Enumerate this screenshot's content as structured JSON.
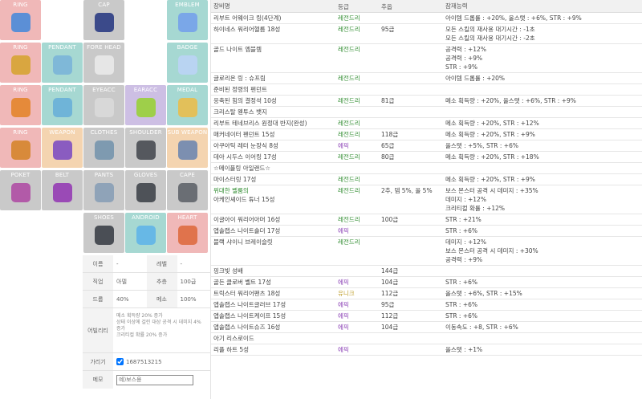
{
  "equipment_grid": {
    "slots": [
      {
        "label": "RING",
        "item": "ring-1"
      },
      {
        "label": "",
        "item": ""
      },
      {
        "label": "CAP",
        "item": "cap"
      },
      {
        "label": "",
        "item": ""
      },
      {
        "label": "EMBLEM",
        "item": "emblem"
      },
      {
        "label": "RING",
        "item": "ring-2"
      },
      {
        "label": "PENDANT",
        "item": "pendant-1"
      },
      {
        "label": "FORE HEAD",
        "item": "forehead"
      },
      {
        "label": "",
        "item": ""
      },
      {
        "label": "BADGE",
        "item": "badge"
      },
      {
        "label": "RING",
        "item": "ring-3"
      },
      {
        "label": "PENDANT",
        "item": "pendant-2"
      },
      {
        "label": "EYEACC",
        "item": "eye-accessory"
      },
      {
        "label": "EARACC",
        "item": "ear-accessory"
      },
      {
        "label": "MEDAL",
        "item": "medal"
      },
      {
        "label": "RING",
        "item": "ring-4"
      },
      {
        "label": "WEAPON",
        "item": "weapon"
      },
      {
        "label": "CLOTHES",
        "item": "clothes"
      },
      {
        "label": "SHOULDER",
        "item": "shoulder"
      },
      {
        "label": "SUB WEAPON",
        "item": "sub-weapon"
      },
      {
        "label": "POKET",
        "item": "pocket"
      },
      {
        "label": "BELT",
        "item": "belt"
      },
      {
        "label": "PANTS",
        "item": "pants"
      },
      {
        "label": "GLOVES",
        "item": "gloves"
      },
      {
        "label": "CAPE",
        "item": "cape"
      },
      {
        "label": "",
        "item": ""
      },
      {
        "label": "",
        "item": ""
      },
      {
        "label": "SHOES",
        "item": "shoes"
      },
      {
        "label": "ANDROID",
        "item": "android"
      },
      {
        "label": "HEART",
        "item": "heart"
      }
    ]
  },
  "char_info": {
    "name_label": "이름",
    "name_value": "-",
    "level_label": "레벨",
    "level_value": "-",
    "job_label": "직업",
    "job_value": "아델",
    "hunt_label": "추층",
    "hunt_value": "100급",
    "drop_label": "드롭",
    "drop_value": "40%",
    "meso_label": "메소",
    "meso_value": "100%",
    "ability_label": "어빌리티",
    "ability_lines": [
      "메소 획득량 20% 증가",
      "상태 이상에 걸린 대상 공격 시 데미지 4% 증가",
      "크리티컬 확률 20% 증가"
    ],
    "hide_label": "가리기",
    "hide_value": "1687513215",
    "memo_label": "메모",
    "memo_placeholder": "예)보스용"
  },
  "table": {
    "headers": {
      "name": "장비명",
      "grade": "등급",
      "star": "추옵",
      "potential": "잠재능력"
    },
    "rows": [
      {
        "name": "리부트 어웨이크 링(4단계)",
        "grade": "레전드리",
        "grade_class": "legend",
        "star": "",
        "potential": [
          "아이템 드롭률 : +20%, 올스탯 : +6%, STR : +9%"
        ]
      },
      {
        "name": "하이네스 워리어헬름 18성",
        "grade": "레전드리",
        "grade_class": "legend",
        "star": "95급",
        "potential": [
          "모든 스킬의 재사용 대기시간 : -1초",
          "모든 스킬의 재사용 대기시간 : -2초"
        ]
      },
      {
        "name": "골드 나이트 엠블렘",
        "grade": "레전드리",
        "grade_class": "legend",
        "star": "",
        "potential": [
          "공격력 : +12%",
          "공격력 : +9%",
          "STR : +9%"
        ]
      },
      {
        "name": "글로리온 링 : 슈프림",
        "grade": "레전드리",
        "grade_class": "legend",
        "star": "",
        "potential": [
          "아이템 드롭률 : +20%"
        ]
      },
      {
        "name": "준비된 정령의 펜던트",
        "grade": "",
        "grade_class": "",
        "star": "",
        "potential": []
      },
      {
        "name": "응축된 힘의 결정석 10성",
        "grade": "레전드리",
        "grade_class": "legend",
        "star": "81급",
        "potential": [
          "메소 획득량 : +20%, 올스탯 : +6%, STR : +9%"
        ]
      },
      {
        "name": "크리스탈 웬투스 뱃지",
        "grade": "",
        "grade_class": "",
        "star": "",
        "potential": []
      },
      {
        "name": "리부트 테네브리스 원정대 반지(완성)",
        "grade": "레전드리",
        "grade_class": "legend",
        "star": "",
        "potential": [
          "메소 획득량 : +20%, STR : +12%"
        ]
      },
      {
        "name": "매커네이터 펜던트 15성",
        "grade": "레전드리",
        "grade_class": "legend",
        "star": "118급",
        "potential": [
          "메소 획득량 : +20%, STR : +9%"
        ]
      },
      {
        "name": "아쿠아틱 레터 눈장식 8성",
        "grade": "에픽",
        "grade_class": "epic",
        "star": "65급",
        "potential": [
          "올스탯 : +5%, STR : +6%"
        ]
      },
      {
        "name": "데아 시두스 이어링 17성",
        "grade": "레전드리",
        "grade_class": "legend",
        "star": "80급",
        "potential": [
          "메소 획득량 : +20%, STR : +18%"
        ]
      },
      {
        "name": "☆메이플링 아일랜드☆",
        "grade": "",
        "grade_class": "",
        "star": "",
        "potential": []
      },
      {
        "name": "마이스터링 17성",
        "grade": "레전드리",
        "grade_class": "legend",
        "star": "",
        "potential": [
          "메소 획득량 : +20%, STR : +9%"
        ]
      },
      {
        "name": "위대한 벨룸의",
        "name_sub": "아케인셰이드 튜너 15성",
        "grade": "레전드리",
        "grade_class": "legend",
        "star": "2추, 뎀 5%, 올 5%",
        "potential": [
          "보스 몬스터 공격 시 데미지 : +35%",
          "데미지 : +12%",
          "크리티컬 확률 : +12%"
        ]
      },
      {
        "name": "이글아이 워리어아머 16성",
        "grade": "레전드리",
        "grade_class": "legend",
        "star": "100급",
        "potential": [
          "STR : +21%"
        ]
      },
      {
        "name": "앱솔랩스 나이트숄더 17성",
        "grade": "에픽",
        "grade_class": "epic",
        "star": "",
        "potential": [
          "STR : +6%"
        ]
      },
      {
        "name": "블랙 샤이니 브레이슬릿",
        "grade": "레전드리",
        "grade_class": "legend",
        "star": "",
        "potential": [
          "데미지 : +12%",
          "보스 몬스터 공격 시 데미지 : +30%",
          "공격력 : +9%"
        ]
      },
      {
        "name": "핑크빛 성배",
        "grade": "",
        "grade_class": "",
        "star": "144급",
        "potential": []
      },
      {
        "name": "골든 클로버 벨트 17성",
        "grade": "에픽",
        "grade_class": "epic",
        "star": "104급",
        "potential": [
          "STR : +6%"
        ]
      },
      {
        "name": "트릭스터 워리어팬츠 18성",
        "grade": "유니크",
        "grade_class": "unique",
        "star": "112급",
        "potential": [
          "올스탯 : +6%, STR : +15%"
        ]
      },
      {
        "name": "앱솔랩스 나이트글러브 17성",
        "grade": "에픽",
        "grade_class": "epic",
        "star": "95급",
        "potential": [
          "STR : +6%"
        ]
      },
      {
        "name": "앱솔랩스 나이트케이프 15성",
        "grade": "에픽",
        "grade_class": "epic",
        "star": "112급",
        "potential": [
          "STR : +6%"
        ]
      },
      {
        "name": "앱솔랩스 나이트슈즈 16성",
        "grade": "에픽",
        "grade_class": "epic",
        "star": "104급",
        "potential": [
          "이동속도 : +8, STR : +6%"
        ]
      },
      {
        "name": "아기 리스로이드",
        "grade": "",
        "grade_class": "",
        "star": "",
        "potential": []
      },
      {
        "name": "리플 하트 5성",
        "grade": "에픽",
        "grade_class": "epic",
        "star": "",
        "potential": [
          "올스탯 : +1%"
        ]
      }
    ]
  },
  "colors": {
    "legend": "#2e8b2e",
    "epic": "#8a3fb5",
    "unique": "#c0a030"
  }
}
